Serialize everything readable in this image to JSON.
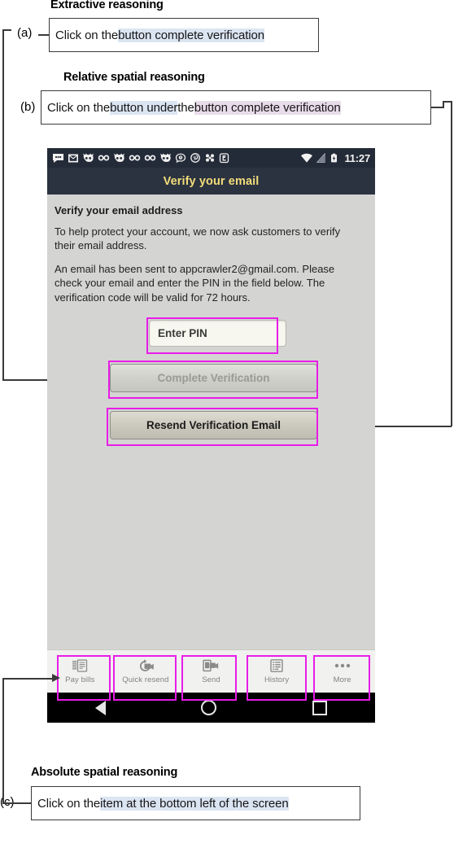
{
  "figure": {
    "panels": [
      {
        "tag": "(a)",
        "heading": "Extractive reasoning",
        "prefix": "Click on the ",
        "highlights": [
          {
            "text": "button complete verification",
            "color": "#dbe5f2"
          }
        ],
        "suffix": ""
      },
      {
        "tag": "(b)",
        "heading": "Relative spatial reasoning",
        "prefix": "Click on the ",
        "mid": " the ",
        "highlights": [
          {
            "text": "button under",
            "color": "#dbe5f2"
          },
          {
            "text": "button complete verification",
            "color": "#e9dcea"
          }
        ]
      },
      {
        "tag": "(c)",
        "heading": "Absolute spatial reasoning",
        "prefix": "Click on the ",
        "highlights": [
          {
            "text": "item at the bottom left of the screen",
            "color": "#dbe5f2"
          }
        ]
      }
    ]
  },
  "phone": {
    "statusbar": {
      "clock": "11:27",
      "icons": [
        "messages-dots-icon",
        "mail-envelope-icon",
        "cat-face-icon",
        "ninety-icon",
        "cat-face-icon",
        "ninety-icon",
        "ninety-icon",
        "cat-face-icon",
        "chat-clock-icon",
        "pinterest-icon",
        "share-clover-icon",
        "e-badge-icon",
        "wifi-icon",
        "signal-icon",
        "battery-charging-icon"
      ]
    },
    "titlebar": {
      "title": "Verify your email",
      "title_color": "#f2dd7a",
      "bg_color": "#2b3240"
    },
    "content": {
      "heading": "Verify your email address",
      "paragraph1": "To help protect your account, we now ask customers to verify their email address.",
      "paragraph2": "An email has been sent to appcrawler2@gmail.com. Please check your email and enter the PIN in the field below. The verification code will be valid for 72 hours.",
      "pin_field": {
        "value": "Enter PIN",
        "placeholder": "Enter PIN"
      },
      "complete_button": "Complete Verification",
      "resend_button": "Resend Verification Email"
    },
    "tabbar": [
      {
        "label": "Pay bills",
        "icon": "pay-bills-icon"
      },
      {
        "label": "Quick resend",
        "icon": "quick-resend-icon"
      },
      {
        "label": "Send",
        "icon": "send-icon"
      },
      {
        "label": "History",
        "icon": "history-icon"
      },
      {
        "label": "More",
        "icon": "more-dots-icon"
      }
    ],
    "navbar": [
      {
        "name": "back-button",
        "icon": "triangle-back-icon"
      },
      {
        "name": "home-button",
        "icon": "circle-home-icon"
      },
      {
        "name": "recents-button",
        "icon": "square-recents-icon"
      }
    ]
  },
  "annotation": {
    "box_color": "#e81ce8"
  }
}
